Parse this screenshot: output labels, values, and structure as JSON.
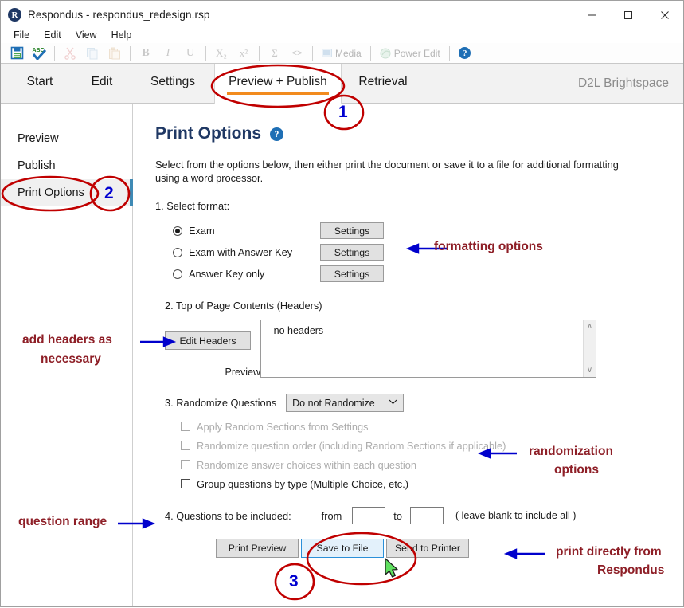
{
  "window": {
    "app_icon": "R",
    "title": "Respondus - respondus_redesign.rsp",
    "minimize": "—",
    "maximize": "□",
    "close": "✕"
  },
  "menubar": {
    "items": [
      {
        "label": "File"
      },
      {
        "label": "Edit"
      },
      {
        "label": "View"
      },
      {
        "label": "Help"
      }
    ]
  },
  "toolbar": {
    "items": [
      {
        "name": "save-icon",
        "label": "💾"
      },
      {
        "name": "spellcheck-icon",
        "label": "ABC"
      },
      {
        "name": "cut-icon",
        "label": "✂"
      },
      {
        "name": "copy-icon",
        "label": "⧉"
      },
      {
        "name": "paste-icon",
        "label": "📋"
      },
      {
        "name": "bold-icon",
        "label": "B"
      },
      {
        "name": "italic-icon",
        "label": "I"
      },
      {
        "name": "underline-icon",
        "label": "U"
      },
      {
        "name": "subscript-icon",
        "label": "X₂"
      },
      {
        "name": "superscript-icon",
        "label": "x²"
      },
      {
        "name": "equation-icon",
        "label": "Σ"
      },
      {
        "name": "html-icon",
        "label": "<>"
      }
    ],
    "media_label": "Media",
    "power_edit_label": "Power Edit",
    "help_label": "?"
  },
  "tabs": {
    "items": [
      {
        "label": "Start",
        "active": false
      },
      {
        "label": "Edit",
        "active": false
      },
      {
        "label": "Settings",
        "active": false
      },
      {
        "label": "Preview + Publish",
        "active": true
      },
      {
        "label": "Retrieval",
        "active": false
      }
    ],
    "brand": "D2L Brightspace",
    "accent_color": "#f28b1e"
  },
  "sidebar": {
    "items": [
      {
        "label": "Preview",
        "active": false
      },
      {
        "label": "Publish",
        "active": false
      },
      {
        "label": "Print Options",
        "active": true
      }
    ],
    "indicator_color": "#3f8ab5"
  },
  "main": {
    "page_title": "Print Options",
    "help_glyph": "?",
    "intro": "Select from the options below, then either print the document or save it to a file for additional formatting using a word processor.",
    "step1_label": "1.  Select format:",
    "formats": [
      {
        "label": "Exam",
        "selected": true,
        "button": "Settings"
      },
      {
        "label": "Exam with Answer Key",
        "selected": false,
        "button": "Settings"
      },
      {
        "label": "Answer Key only",
        "selected": false,
        "button": "Settings"
      }
    ],
    "step2_label": "2.  Top of Page Contents (Headers)",
    "edit_headers_button": "Edit Headers",
    "preview_label": "Preview",
    "headers_box_text": "- no headers -",
    "scroll_up": "∧",
    "scroll_down": "∨",
    "step3_label": "3.  Randomize Questions",
    "randomize_select": {
      "value": "Do not Randomize",
      "chevron": "⌵"
    },
    "checkboxes": [
      {
        "label": "Apply Random Sections from Settings",
        "checked": false,
        "enabled": false
      },
      {
        "label": "Randomize question order (including Random Sections if applicable)",
        "checked": false,
        "enabled": false
      },
      {
        "label": "Randomize answer choices within each question",
        "checked": false,
        "enabled": false
      },
      {
        "label": "Group questions by type (Multiple Choice, etc.)",
        "checked": false,
        "enabled": true
      }
    ],
    "step4_label": "4.  Questions to be included:",
    "from_label": "from",
    "from_value": "",
    "to_label": "to",
    "to_value": "",
    "range_note": "( leave blank to include all )",
    "actions": [
      {
        "label": "Print Preview",
        "state": "normal"
      },
      {
        "label": "Save to File",
        "state": "hover"
      },
      {
        "label": "Send to Printer",
        "state": "normal"
      }
    ]
  },
  "annotations": {
    "color": "#8e1f27",
    "arrow_color": "#0000d0",
    "circle_color": "#c00000",
    "callouts": [
      {
        "id": "formatting",
        "text": "formatting options"
      },
      {
        "id": "add-headers-1",
        "text": "add headers as"
      },
      {
        "id": "add-headers-2",
        "text": "necessary"
      },
      {
        "id": "randomization-1",
        "text": "randomization"
      },
      {
        "id": "randomization-2",
        "text": "options"
      },
      {
        "id": "question-range",
        "text": "question range"
      },
      {
        "id": "print-directly-1",
        "text": "print directly from"
      },
      {
        "id": "print-directly-2",
        "text": "Respondus"
      }
    ],
    "numbers": [
      {
        "id": "marker-1",
        "label": "1"
      },
      {
        "id": "marker-2",
        "label": "2"
      },
      {
        "id": "marker-3",
        "label": "3"
      }
    ]
  }
}
